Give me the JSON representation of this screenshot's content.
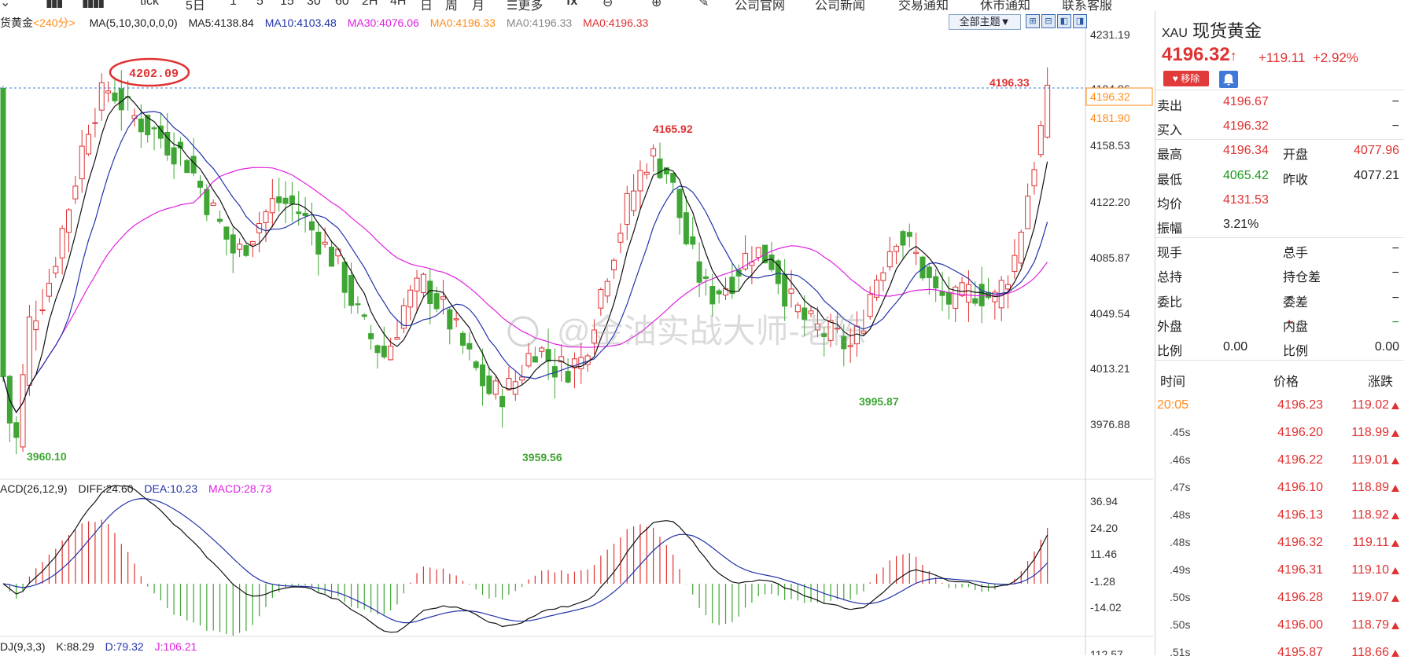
{
  "toolbar": {
    "items": [
      "tick",
      "5日",
      "1",
      "5",
      "15",
      "30",
      "60",
      "2H",
      "4H",
      "日",
      "周",
      "月",
      "更多",
      "fx",
      "公司官网",
      "公司新闻",
      "交易通知",
      "休市通知",
      "联系客服"
    ]
  },
  "main_info": {
    "instrument": "货黄金",
    "period": "<240分>",
    "ma_label": "MA(5,10,30,0,0,0)",
    "ma5": "MA5:4138.84",
    "ma10": "MA10:4103.48",
    "ma30": "MA30:4076.06",
    "ma0a": "MA0:4196.33",
    "ma0b": "MA0:4196.33",
    "ma0c": "MA0:4196.33",
    "theme": "全部主题▼"
  },
  "macd_info": {
    "label": "ACD(26,12,9)",
    "diff": "DIFF:24.60",
    "dea": "DEA:10.23",
    "macd": "MACD:28.73"
  },
  "kdj_info": {
    "label": "DJ(9,3,3)",
    "k": "K:88.29",
    "d": "D:79.32",
    "j": "J:106.21",
    "cut_axis": "112.57"
  },
  "price_axis": [
    "4231.19",
    "4194.86",
    "4158.53",
    "4122.20",
    "4085.87",
    "4049.54",
    "4013.21",
    "3976.88"
  ],
  "price_tags": {
    "current": "4196.32",
    "second": "4181.90"
  },
  "annotations": {
    "high_circle": "4202.09",
    "last_high": "4196.33",
    "mid_high": "4165.92",
    "low_left": "3960.10",
    "low_mid": "3959.56",
    "low_right": "3995.87"
  },
  "macd_axis": [
    "36.94",
    "24.20",
    "11.46",
    "-1.28",
    "-14.02"
  ],
  "watermark": "@金油实战大师-老陈",
  "colors": {
    "up": "#e03232",
    "down": "#3fa534",
    "ma10": "#2233aa",
    "ma30": "#e020e0",
    "ma0": "#ff8c1a"
  },
  "panel": {
    "code": "XAU",
    "name": "现货黄金",
    "price": "4196.32",
    "change": "+119.11",
    "change_pct": "+2.92%",
    "remove_btn": "♥ 移除",
    "rows": [
      {
        "l1": "卖出",
        "v1": "4196.67",
        "l2": "",
        "v2": "−",
        "c1": "red",
        "c2": "dark"
      },
      {
        "l1": "买入",
        "v1": "4196.32",
        "l2": "",
        "v2": "−",
        "c1": "red",
        "c2": "dark"
      },
      {
        "l1": "最高",
        "v1": "4196.34",
        "l2": "开盘",
        "v2": "4077.96",
        "c1": "red",
        "c2": "red"
      },
      {
        "l1": "最低",
        "v1": "4065.42",
        "l2": "昨收",
        "v2": "4077.21",
        "c1": "green",
        "c2": "dark"
      },
      {
        "l1": "均价",
        "v1": "4131.53",
        "l2": "",
        "v2": "",
        "c1": "red",
        "c2": "dark"
      },
      {
        "l1": "振幅",
        "v1": "3.21%",
        "l2": "",
        "v2": "",
        "c1": "dark",
        "c2": "dark"
      },
      {
        "l1": "现手",
        "v1": "−",
        "l2": "总手",
        "v2": "−",
        "c1": "dark",
        "c2": "dark"
      },
      {
        "l1": "总持",
        "v1": "−",
        "l2": "持仓差",
        "v2": "−",
        "c1": "dark",
        "c2": "dark"
      },
      {
        "l1": "委比",
        "v1": "−",
        "l2": "委差",
        "v2": "−",
        "c1": "dark",
        "c2": "dark"
      },
      {
        "l1": "外盘",
        "v1": "−",
        "l2": "内盘",
        "v2": "−",
        "c1": "red",
        "c2": "green"
      },
      {
        "l1": "比例",
        "v1": "0.00",
        "l2": "比例",
        "v2": "0.00",
        "c1": "dark",
        "c2": "dark"
      }
    ],
    "ticks_header": {
      "time": "时间",
      "price": "价格",
      "change": "涨跌"
    },
    "ticks": [
      {
        "time": "20:05",
        "price": "4196.23",
        "change": "119.02"
      },
      {
        "time": ".45s",
        "price": "4196.20",
        "change": "118.99"
      },
      {
        "time": ".46s",
        "price": "4196.22",
        "change": "119.01"
      },
      {
        "time": ".47s",
        "price": "4196.10",
        "change": "118.89"
      },
      {
        "time": ".48s",
        "price": "4196.13",
        "change": "118.92"
      },
      {
        "time": ".48s",
        "price": "4196.32",
        "change": "119.11"
      },
      {
        "time": ".49s",
        "price": "4196.31",
        "change": "119.10"
      },
      {
        "time": ".50s",
        "price": "4196.28",
        "change": "119.07"
      },
      {
        "time": ".50s",
        "price": "4196.00",
        "change": "118.79"
      },
      {
        "time": ".51s",
        "price": "4195.87",
        "change": "118.66"
      }
    ]
  }
}
